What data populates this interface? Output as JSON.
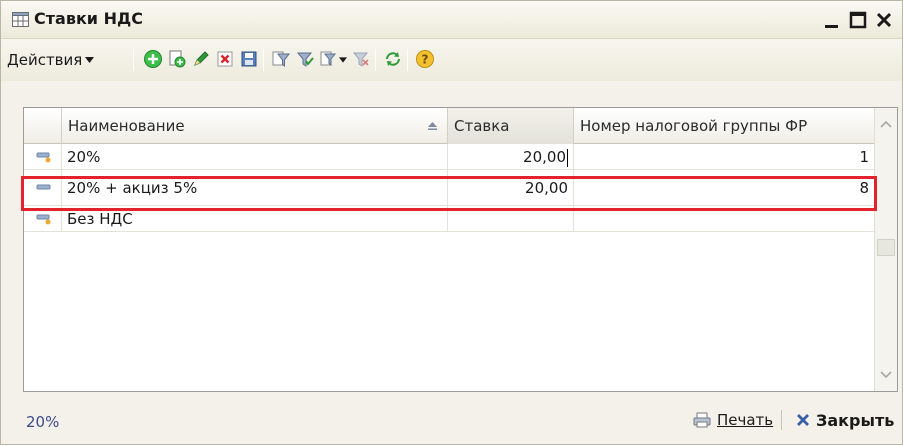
{
  "window": {
    "title": "Ставки НДС",
    "minimize_icon": "minimize-icon",
    "maximize_icon": "maximize-icon",
    "close_icon": "close-icon"
  },
  "toolbar": {
    "actions_label": "Действия",
    "icons": [
      "add-icon",
      "copy-icon",
      "edit-icon",
      "delete-icon",
      "save-icon",
      "filter-icon",
      "filter-apply-icon",
      "filter-dropdown-icon",
      "filter-clear-icon",
      "refresh-icon",
      "help-icon"
    ]
  },
  "table": {
    "columns": [
      "Наименование",
      "Ставка",
      "Номер налоговой группы ФР"
    ],
    "rows": [
      {
        "name": "20%",
        "rate": "20,00",
        "group": "1",
        "icon": "item-icon"
      },
      {
        "name": "20% + акциз 5%",
        "rate": "20,00",
        "group": "8",
        "icon": "item-icon"
      },
      {
        "name": "Без НДС",
        "rate": "",
        "group": "",
        "icon": "item-icon"
      }
    ]
  },
  "status": {
    "current": "20%",
    "print_label": "Печать",
    "close_label": "Закрыть"
  },
  "colors": {
    "highlight": "#e3232c",
    "status_text": "#3b4a8a",
    "add_icon": "#3bbf4a",
    "delete_icon": "#d6242b"
  }
}
